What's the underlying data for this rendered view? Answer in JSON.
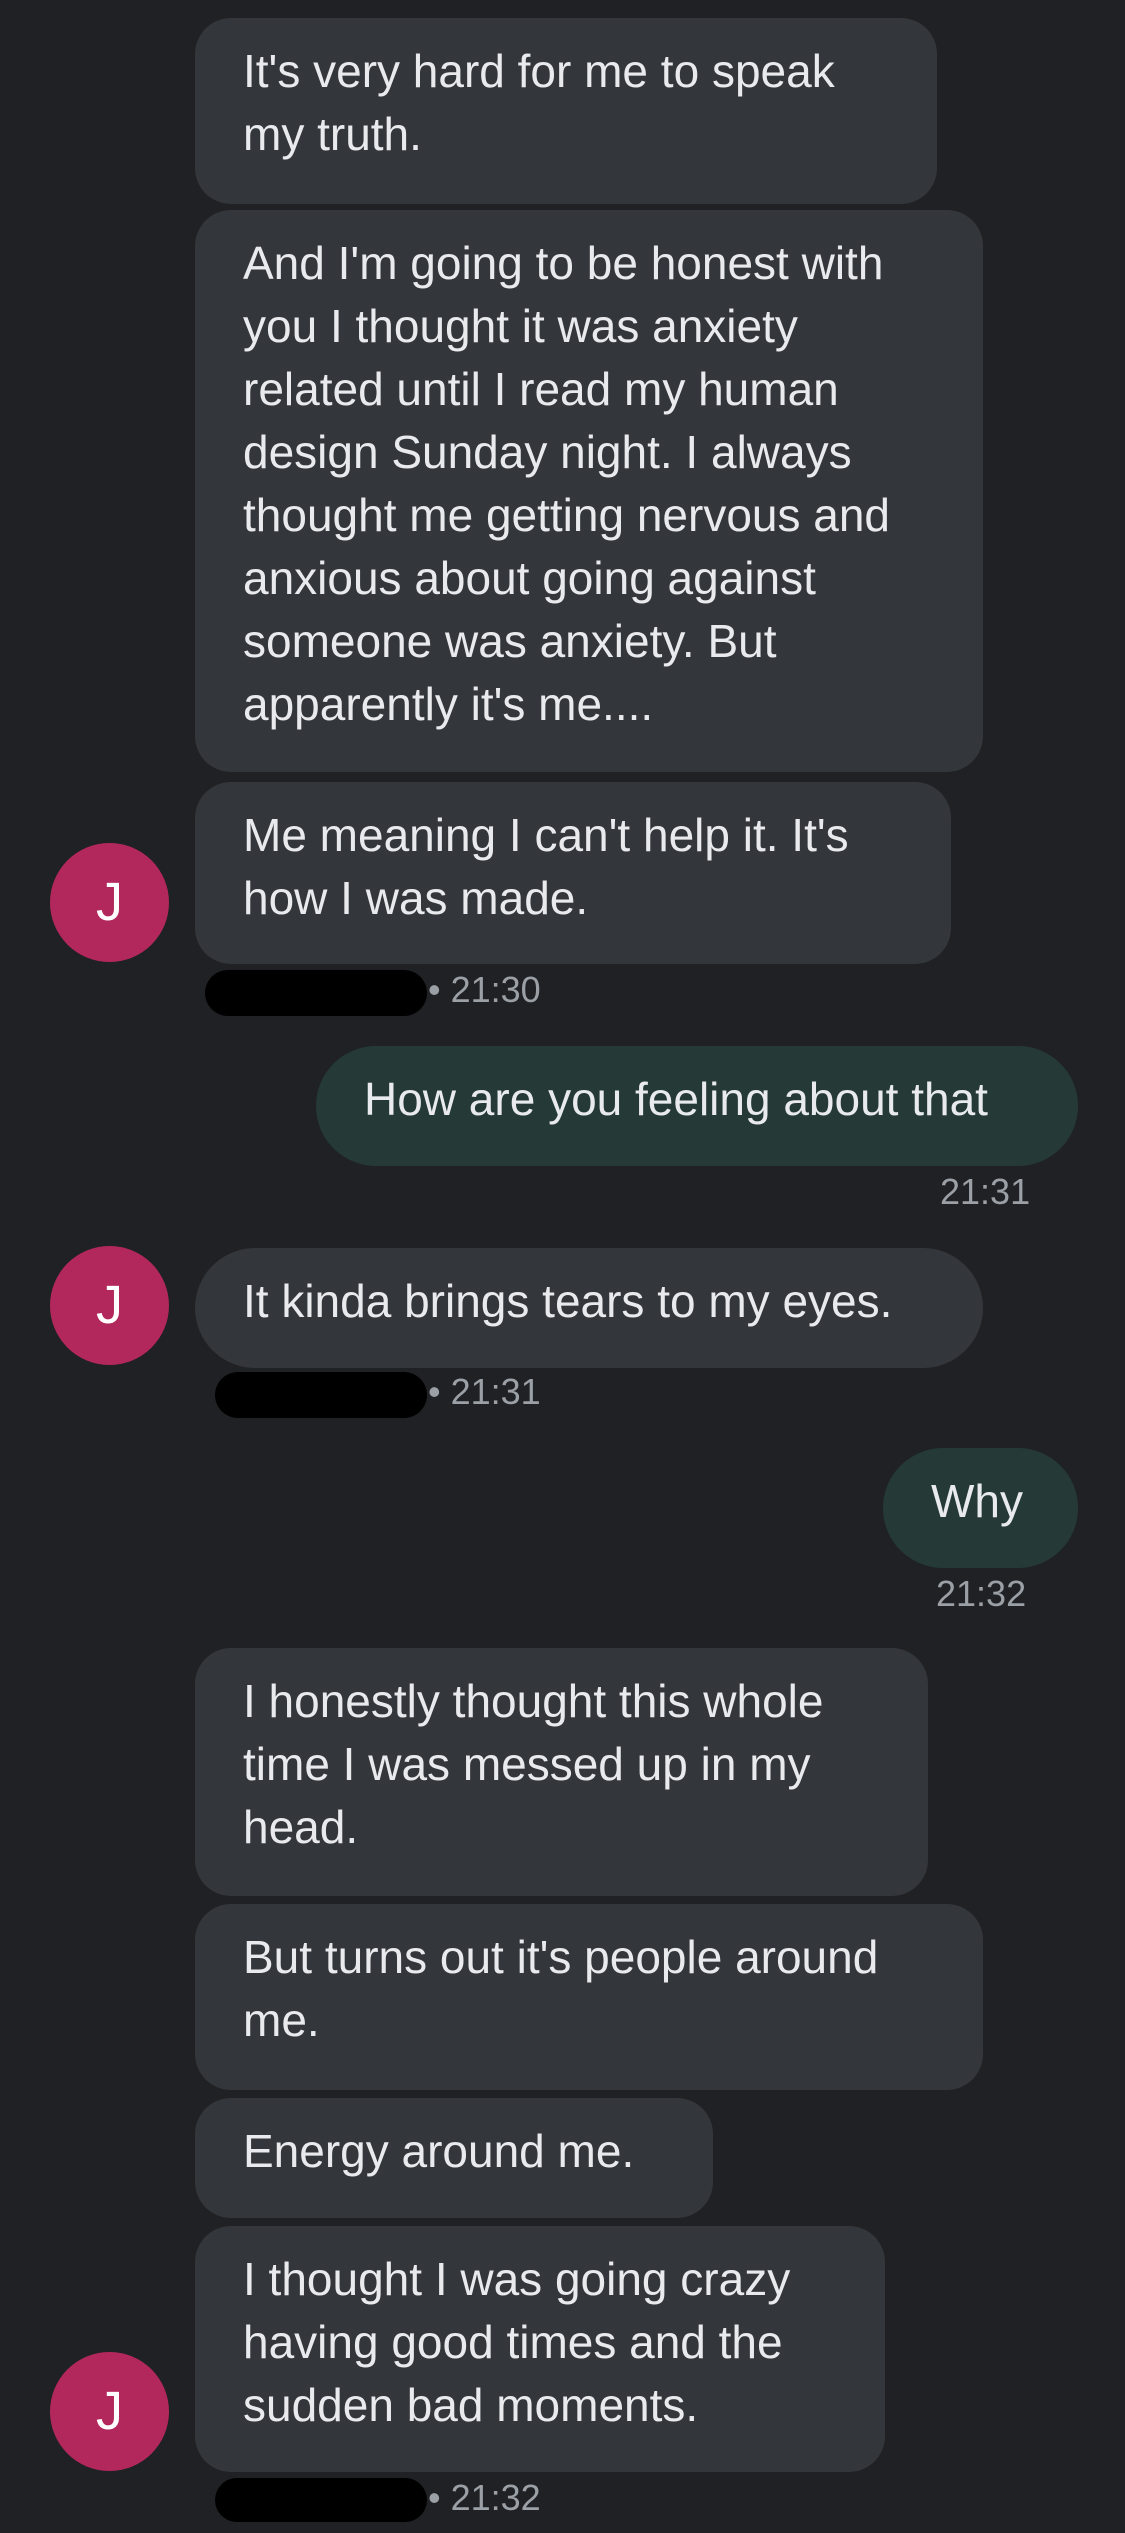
{
  "messages": {
    "m1": "It's very hard for me to speak my truth.",
    "m2": "And I'm going to be honest with you I thought it was anxiety related until I read my human design Sunday night. I always thought me getting nervous and anxious about going against someone was anxiety. But apparently it's me....",
    "m3": "Me meaning I can't help it. It's how I was made.",
    "m4": "How are you feeling about that",
    "m5": "It kinda brings tears to my eyes.",
    "m6": "Why",
    "m7": "I honestly thought this whole time I was messed up in my head.",
    "m8": "But turns out it's people around me.",
    "m9": "Energy around me.",
    "m10": "I thought I was going crazy having good times and the sudden bad moments."
  },
  "timestamps": {
    "t1": "21:30",
    "t2": "21:31",
    "t3": "21:31",
    "t4": "21:32",
    "t5": "21:32"
  },
  "avatar": {
    "initial": "J",
    "color": "#b3285c"
  },
  "colors": {
    "background": "#202124",
    "incoming_bubble": "#33363a",
    "outgoing_bubble": "#253a37",
    "text": "#e8eaed",
    "meta_text": "#9aa0a6"
  }
}
